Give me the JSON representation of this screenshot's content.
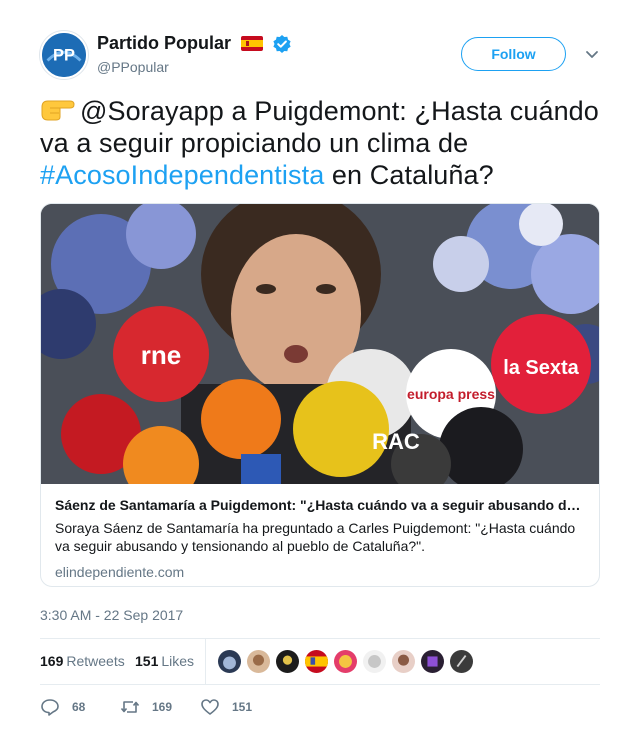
{
  "user": {
    "display_name": "Partido Popular",
    "screen_name": "@PPopular",
    "avatar_text": "PP",
    "flag_icon": "spain-flag-icon",
    "verified_icon": "verified-badge-icon"
  },
  "follow_label": "Follow",
  "tweet": {
    "emoji": "backhand-index-pointing-right-icon",
    "text_before": "@Sorayapp a Puigdemont: ¿Hasta cuándo va a seguir propiciando un clima de ",
    "hashtag": "#AcosoIndependentista",
    "text_after": " en Cataluña?"
  },
  "card": {
    "title": "Sáenz de Santamaría a Puigdemont: \"¿Hasta cuándo va a seguir abusando d…",
    "description": "Soraya Sáenz de Santamaría ha preguntado a Carles Puigdemont: \"¿Hasta cuándo va seguir abusando y tensionando al pueblo de Cataluña?\".",
    "domain": "elindependiente.com",
    "mic_labels": [
      "rne",
      "europa press",
      "RAC",
      "la Sexta"
    ]
  },
  "timestamp": "3:30 AM - 22 Sep 2017",
  "stats": {
    "retweets_count": "169",
    "retweets_label": "Retweets",
    "likes_count": "151",
    "likes_label": "Likes"
  },
  "actions": {
    "replies": "68",
    "retweets": "169",
    "likes": "151"
  },
  "colors": {
    "accent": "#1da1f2",
    "text": "#14171a",
    "muted": "#657786",
    "border": "#e1e8ed"
  }
}
